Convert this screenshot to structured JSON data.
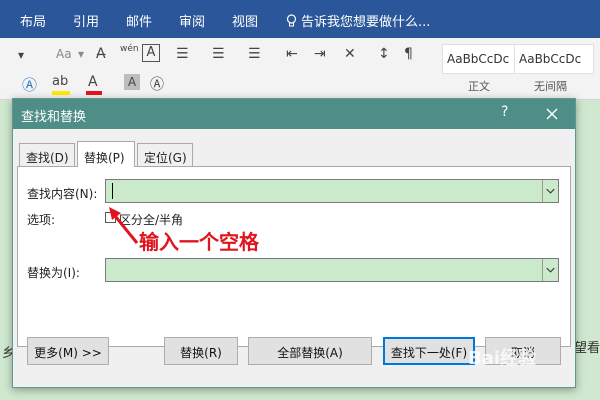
{
  "ribbon": {
    "tabs": [
      "布局",
      "引用",
      "邮件",
      "审阅",
      "视图"
    ],
    "tell_me": "告诉我您想要做什么...",
    "font_size_label": "Aa",
    "phonetic_label": "wén",
    "styles": [
      {
        "preview": "AaBbCcDc",
        "name": "正文"
      },
      {
        "preview": "AaBbCcDc",
        "name": "无间隔"
      }
    ]
  },
  "background_text": {
    "left_char": "乡",
    "right_text": "望看"
  },
  "dialog": {
    "title": "查找和替换",
    "help": "?",
    "tabs": [
      {
        "label": "查找(D)",
        "active": false
      },
      {
        "label": "替换(P)",
        "active": true
      },
      {
        "label": "定位(G)",
        "active": false
      }
    ],
    "find_label": "查找内容(N):",
    "find_value": "",
    "options_label": "选项:",
    "options_value": "区分全/半角",
    "replace_label": "替换为(I):",
    "replace_value": "",
    "buttons": {
      "more": "更多(M) >>",
      "replace": "替换(R)",
      "replace_all": "全部替换(A)",
      "find_next": "查找下一处(F)",
      "cancel": "取消"
    }
  },
  "annotation": {
    "text": "输入一个空格",
    "color": "#e0141e"
  },
  "watermark": "Bai经验",
  "colors": {
    "ribbon_blue": "#2b579a",
    "dialog_title": "#4e8e87",
    "field_bg": "#cbeacb"
  }
}
